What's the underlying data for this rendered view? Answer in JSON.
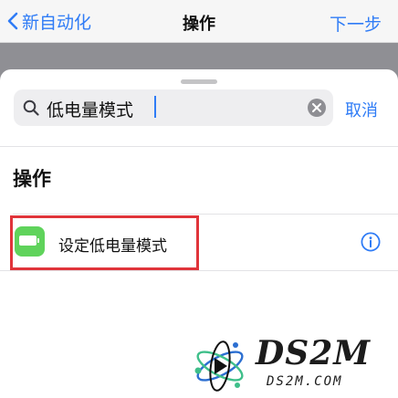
{
  "nav": {
    "back_label": "新自动化",
    "title": "操作",
    "next_label": "下一步"
  },
  "search": {
    "value": "低电量模式",
    "cancel_label": "取消"
  },
  "section": {
    "title": "操作"
  },
  "actions": [
    {
      "label": "设定低电量模式",
      "icon": "battery-icon",
      "icon_color": "#5fd35b"
    }
  ],
  "colors": {
    "accent": "#2f7cf6",
    "highlight": "#e0343a",
    "dim_background": "#8f8f94"
  },
  "watermark": {
    "main": "DS2M",
    "sub": "DS2M.COM"
  }
}
